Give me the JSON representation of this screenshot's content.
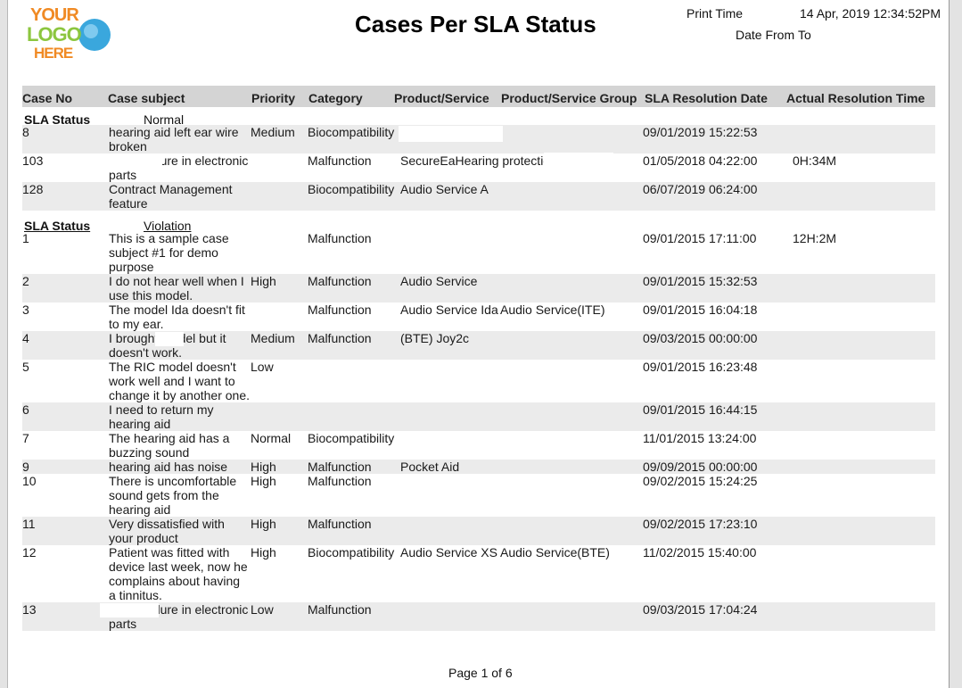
{
  "header": {
    "logo": {
      "line1": "YOUR",
      "line2": "LOGO",
      "line3": "HERE"
    },
    "title": "Cases Per SLA Status",
    "print_time_label": "Print Time",
    "print_time_value": "14 Apr, 2019 12:34:52PM",
    "date_from_label": "Date From",
    "date_to_label": "To"
  },
  "columns": [
    "Case No",
    "Case subject",
    "Priority",
    "Category",
    "Product/Service",
    "Product/Service Group",
    "SLA Resolution Date",
    "Actual Resolution Time"
  ],
  "groups": [
    {
      "label": "SLA Status",
      "value": "Normal",
      "rows": [
        {
          "case_no": "8",
          "subject": "hearing aid left ear wire broken",
          "priority": "Medium",
          "category": "Biocompatibility",
          "product": "",
          "group": "",
          "sla_date": "09/01/2019 15:22:53",
          "actual": ""
        },
        {
          "case_no": "103",
          "subject": "levice failure in electronic parts",
          "priority": "",
          "category": "Malfunction",
          "product": "SecureEaHearing protection",
          "group": "",
          "sla_date": "01/05/2018 04:22:00",
          "actual": "0H:34M"
        },
        {
          "case_no": "128",
          "subject": "Contract Management feature",
          "priority": "",
          "category": "Biocompatibility",
          "product": "Audio Service A",
          "group": "",
          "sla_date": "06/07/2019 06:24:00",
          "actual": ""
        }
      ]
    },
    {
      "label": "SLA Status",
      "value": "Violation",
      "rows": [
        {
          "case_no": "1",
          "subject": "This is a sample case subject #1 for demo purpose",
          "priority": "",
          "category": "Malfunction",
          "product": "",
          "group": "",
          "sla_date": "09/01/2015 17:11:00",
          "actual": "12H:2M"
        },
        {
          "case_no": "2",
          "subject": "I do not hear  well when I use this model.",
          "priority": "High",
          "category": "Malfunction",
          "product": "Audio Service",
          "group": "",
          "sla_date": "09/01/2015 15:32:53",
          "actual": ""
        },
        {
          "case_no": "3",
          "subject": "The model Ida doesn't fit to my ear.",
          "priority": "",
          "category": "Malfunction",
          "product": "Audio Service Ida",
          "group": "Audio Service(ITE)",
          "sla_date": "09/01/2015 16:04:18",
          "actual": ""
        },
        {
          "case_no": "4",
          "subject": "I brought            model but it doesn't work.",
          "priority": "Medium",
          "category": "Malfunction",
          "product": "(BTE)  Joy2c",
          "group": "",
          "sla_date": "09/03/2015 00:00:00",
          "actual": ""
        },
        {
          "case_no": "5",
          "subject": "The RIC model doesn't work well and I want to change it by another one.",
          "priority": "Low",
          "category": "",
          "product": "",
          "group": "",
          "sla_date": "09/01/2015 16:23:48",
          "actual": ""
        },
        {
          "case_no": "6",
          "subject": "I need to return my hearing aid",
          "priority": "",
          "category": "",
          "product": "",
          "group": "",
          "sla_date": "09/01/2015 16:44:15",
          "actual": ""
        },
        {
          "case_no": "7",
          "subject": "The hearing aid has a buzzing sound",
          "priority": "Normal",
          "category": "Biocompatibility",
          "product": "",
          "group": "",
          "sla_date": "11/01/2015 13:24:00",
          "actual": ""
        },
        {
          "case_no": "9",
          "subject": "hearing aid has noise",
          "priority": "High",
          "category": "Malfunction",
          "product": "Pocket Aid",
          "group": "",
          "sla_date": "09/09/2015 00:00:00",
          "actual": ""
        },
        {
          "case_no": "10",
          "subject": "There is uncomfortable sound gets from the hearing aid",
          "priority": "High",
          "category": "Malfunction",
          "product": "",
          "group": "",
          "sla_date": "09/02/2015 15:24:25",
          "actual": ""
        },
        {
          "case_no": "11",
          "subject": "Very dissatisfied with your product",
          "priority": "High",
          "category": "Malfunction",
          "product": "",
          "group": "",
          "sla_date": "09/02/2015 17:23:10",
          "actual": ""
        },
        {
          "case_no": "12",
          "subject": "Patient was fitted with device last week, now he complains about having a tinnitus.",
          "priority": "High",
          "category": "Biocompatibility",
          "product": "Audio Service XS",
          "group": "Audio Service(BTE)",
          "sla_date": "11/02/2015 15:40:00",
          "actual": ""
        },
        {
          "case_no": "13",
          "subject": "levice failure in electronic parts",
          "priority": "Low",
          "category": "Malfunction",
          "product": "",
          "group": "",
          "sla_date": "09/03/2015 17:04:24",
          "actual": ""
        }
      ]
    }
  ],
  "footer": {
    "page_text": "Page 1 of 6"
  }
}
